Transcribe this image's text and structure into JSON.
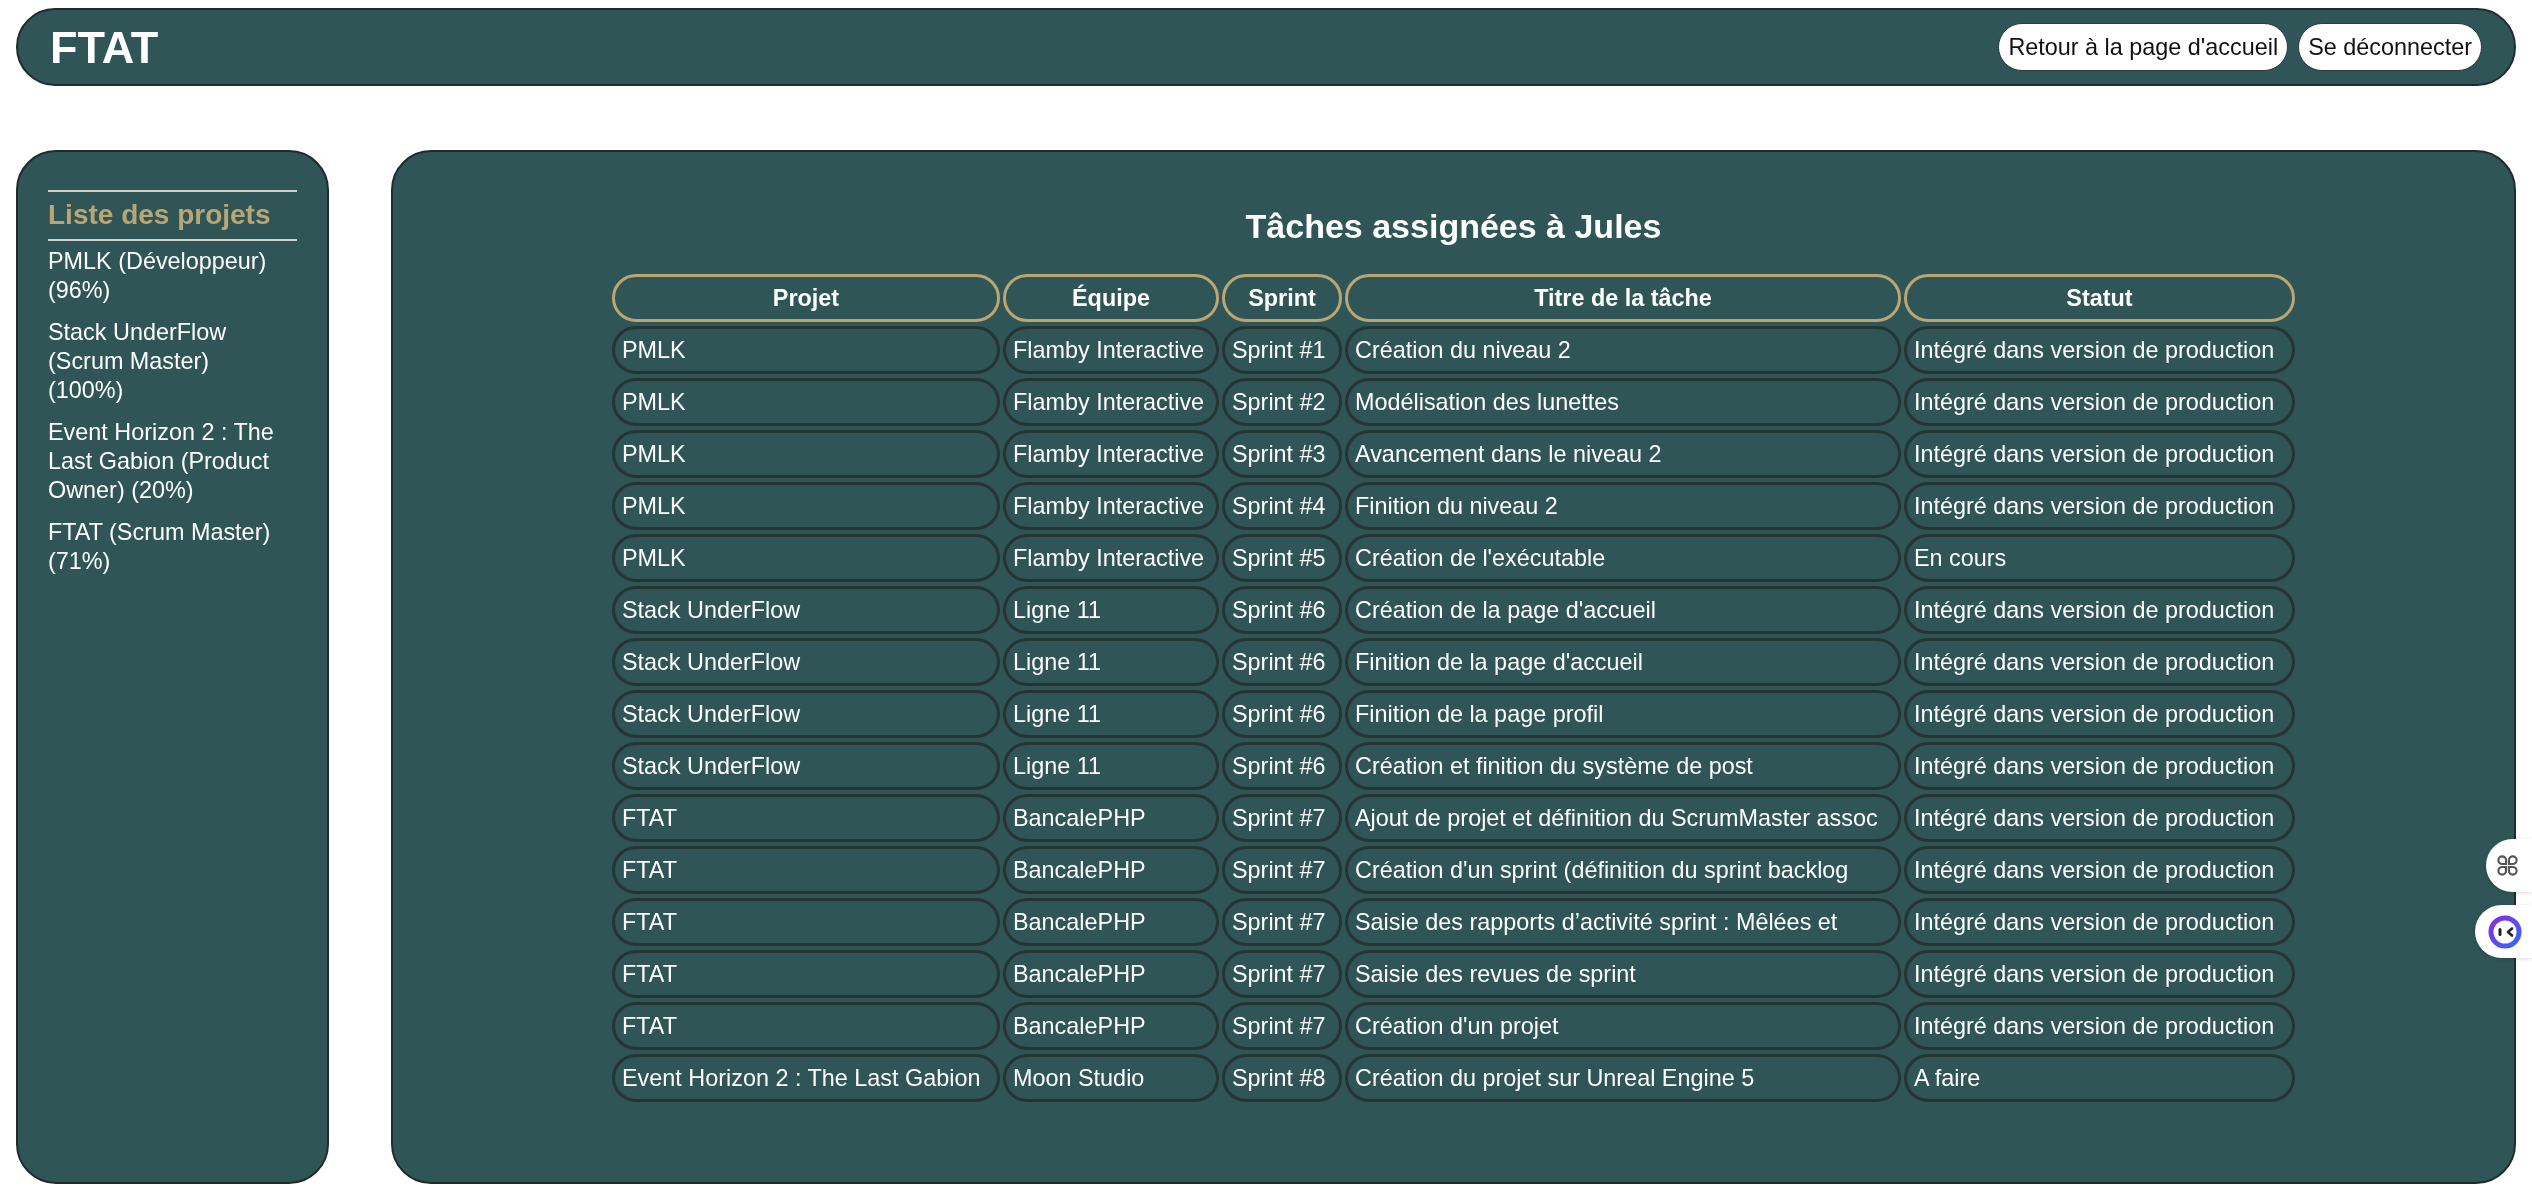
{
  "header": {
    "title": "FTAT",
    "buttons": [
      "Retour à la page d'accueil",
      "Se déconnecter"
    ]
  },
  "sidebar": {
    "heading": "Liste des projets",
    "projects": [
      "PMLK (Développeur) (96%)",
      "Stack UnderFlow (Scrum Master) (100%)",
      "Event Horizon 2 : The Last Gabion (Product Owner) (20%)",
      "FTAT (Scrum Master) (71%)"
    ]
  },
  "tasks": {
    "title": "Tâches assignées à Jules",
    "columns": [
      "Projet",
      "Équipe",
      "Sprint",
      "Titre de la tâche",
      "Statut"
    ],
    "rows": [
      [
        "PMLK",
        "Flamby Interactive",
        "Sprint #1",
        "Création du niveau 2",
        "Intégré dans version de production"
      ],
      [
        "PMLK",
        "Flamby Interactive",
        "Sprint #2",
        "Modélisation des lunettes",
        "Intégré dans version de production"
      ],
      [
        "PMLK",
        "Flamby Interactive",
        "Sprint #3",
        "Avancement dans le niveau 2",
        "Intégré dans version de production"
      ],
      [
        "PMLK",
        "Flamby Interactive",
        "Sprint #4",
        "Finition du niveau 2",
        "Intégré dans version de production"
      ],
      [
        "PMLK",
        "Flamby Interactive",
        "Sprint #5",
        "Création de l'exécutable",
        "En cours"
      ],
      [
        "Stack UnderFlow",
        "Ligne 11",
        "Sprint #6",
        "Création de la page d'accueil",
        "Intégré dans version de production"
      ],
      [
        "Stack UnderFlow",
        "Ligne 11",
        "Sprint #6",
        "Finition de la page d'accueil",
        "Intégré dans version de production"
      ],
      [
        "Stack UnderFlow",
        "Ligne 11",
        "Sprint #6",
        "Finition de la page profil",
        "Intégré dans version de production"
      ],
      [
        "Stack UnderFlow",
        "Ligne 11",
        "Sprint #6",
        "Création et finition du système de post",
        "Intégré dans version de production"
      ],
      [
        "FTAT",
        "BancalePHP",
        "Sprint #7",
        "Ajout de projet et définition du ScrumMaster assoc",
        "Intégré dans version de production"
      ],
      [
        "FTAT",
        "BancalePHP",
        "Sprint #7",
        "Création d'un sprint (définition du sprint backlog",
        "Intégré dans version de production"
      ],
      [
        "FTAT",
        "BancalePHP",
        "Sprint #7",
        "Saisie des rapports d’activité sprint : Mêlées et",
        "Intégré dans version de production"
      ],
      [
        "FTAT",
        "BancalePHP",
        "Sprint #7",
        "Saisie des revues de sprint",
        "Intégré dans version de production"
      ],
      [
        "FTAT",
        "BancalePHP",
        "Sprint #7",
        "Création d'un projet",
        "Intégré dans version de production"
      ],
      [
        "Event Horizon 2 : The Last Gabion",
        "Moon Studio",
        "Sprint #8",
        "Création du projet sur Unreal Engine 5",
        "A faire"
      ]
    ]
  }
}
